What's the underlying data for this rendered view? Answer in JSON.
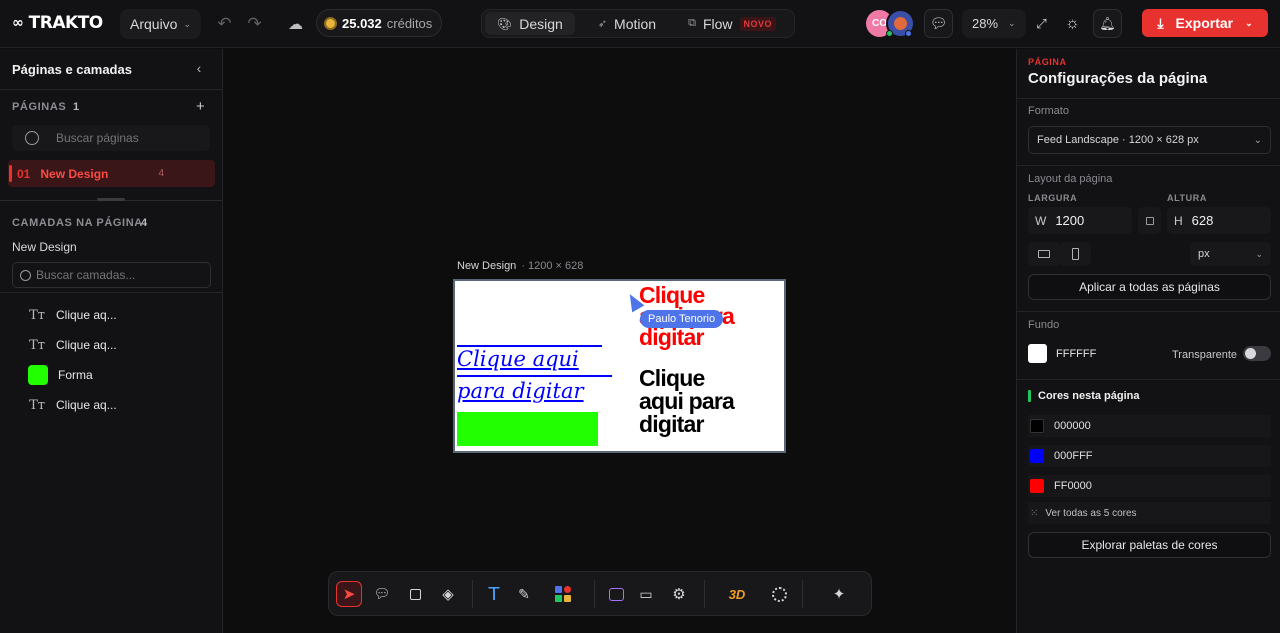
{
  "app": {
    "logo": "TRAKTO"
  },
  "topbar": {
    "file_menu": "Arquivo",
    "credits_value": "25.032",
    "credits_label": "créditos",
    "modes": [
      {
        "label": "Design",
        "active": true
      },
      {
        "label": "Motion",
        "active": false
      },
      {
        "label": "Flow",
        "active": false,
        "badge": "NOVO"
      }
    ],
    "avatar_initials": "CO",
    "zoom": "28%",
    "export_label": "Exportar"
  },
  "left_panel": {
    "title": "Páginas e camadas",
    "pages_section": "PÁGINAS",
    "pages_count": "1",
    "search_pages_placeholder": "Buscar páginas",
    "pages": [
      {
        "number": "01",
        "name": "New Design",
        "count": "4"
      }
    ],
    "layers_section": "CAMADAS NA PÁGINA",
    "layers_count": "4",
    "page_name": "New Design",
    "search_layers_placeholder": "Buscar camadas...",
    "layers": [
      {
        "icon": "text-icon",
        "name": "Clique aq..."
      },
      {
        "icon": "text-icon",
        "name": "Clique aq..."
      },
      {
        "icon": "shape-swatch",
        "name": "Forma",
        "color": "#22ff00"
      },
      {
        "icon": "text-icon",
        "name": "Clique aq..."
      }
    ]
  },
  "canvas": {
    "label": "New Design",
    "size_label": "· 1200 × 628",
    "script_text_line1": "Clique aqui",
    "script_text_line2": "para digitar",
    "script_color": "#0000ff",
    "shape_color": "#22ff00",
    "red_text_line1": "Clique",
    "red_text_line2": "aqui para",
    "red_text_line3": "digitar",
    "red_color": "#ff0000",
    "black_text_line1": "Clique",
    "black_text_line2": "aqui para",
    "black_text_line3": "digitar",
    "collaborator_name": "Paulo Tenorio",
    "collaborator_color": "#4d74e8"
  },
  "right_panel": {
    "kicker": "PÁGINA",
    "title": "Configurações da página",
    "format_label": "Formato",
    "format_value": "Feed Landscape · 1200 × 628 px",
    "layout_label": "Layout da página",
    "width_label": "LARGURA",
    "height_label": "ALTURA",
    "width_prefix": "W",
    "width_value": "1200",
    "height_prefix": "H",
    "height_value": "628",
    "unit_value": "px",
    "apply_all_label": "Aplicar a todas as páginas",
    "background_label": "Fundo",
    "background_value": "FFFFFF",
    "transparent_label": "Transparente",
    "transparent_on": false,
    "page_colors_label": "Cores nesta página",
    "colors": [
      {
        "hex": "000000",
        "swatch": "#000000"
      },
      {
        "hex": "000FFF",
        "swatch": "#0000ff"
      },
      {
        "hex": "FF0000",
        "swatch": "#ff0000"
      }
    ],
    "see_all_colors": "Ver todas as 5 cores",
    "explore_palettes": "Explorar paletas de cores"
  },
  "bottom_toolbar": {
    "tools": [
      "select-icon",
      "comment-icon",
      "frame-icon",
      "layers-icon",
      "text-tool-icon",
      "pen-icon",
      "elements-icon",
      "image-icon",
      "video-icon",
      "settings-icon",
      "3d-icon",
      "fingerprint-icon",
      "ai-sparkle-icon"
    ],
    "label_3d": "3D"
  }
}
